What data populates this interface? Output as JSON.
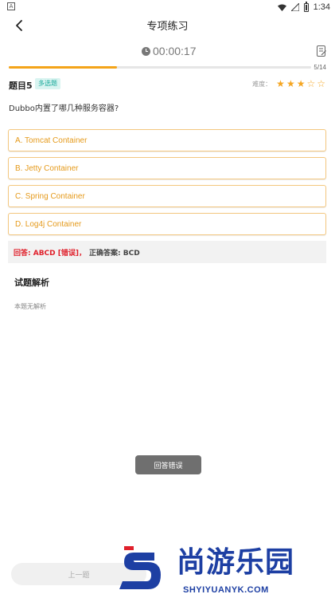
{
  "status_bar": {
    "app_badge": "A",
    "time": "1:34"
  },
  "nav": {
    "title": "专项练习"
  },
  "timer": {
    "value": "00:00:17"
  },
  "progress": {
    "current": 5,
    "total": 14,
    "label": "5/14",
    "fraction": 0.357
  },
  "question": {
    "number_label": "题目5",
    "type_label": "多选题",
    "difficulty_label": "难度：",
    "difficulty_rating": 3,
    "difficulty_max": 5,
    "text": "Dubbo内置了哪几种服务容器?",
    "options": [
      {
        "label": "A. Tomcat Container"
      },
      {
        "label": "B. Jetty Container"
      },
      {
        "label": "C. Spring Container"
      },
      {
        "label": "D. Log4j Container"
      }
    ]
  },
  "result": {
    "answer_text": "回答: ABCD [错误]，",
    "correct_text": "正确答案: BCD"
  },
  "analysis": {
    "title": "试题解析",
    "text": "本题无解析"
  },
  "toast": {
    "text": "回答错误"
  },
  "footer": {
    "prev_label": "上一题"
  },
  "watermark": {
    "cn": "尚游乐园",
    "en": "SHYIYUANYK.COM"
  },
  "colors": {
    "accent": "#f4a419",
    "option_text": "#e59a1b",
    "option_border": "#f3c77f",
    "wrong": "#e0202b",
    "type_badge_bg": "#d9f4f1",
    "type_badge_text": "#19a99a",
    "watermark_blue": "#1d3fa3"
  },
  "icons": {
    "back": "chevron-left-icon",
    "clock": "clock-icon",
    "answer_sheet": "edit-note-icon",
    "star": "star-icon"
  }
}
